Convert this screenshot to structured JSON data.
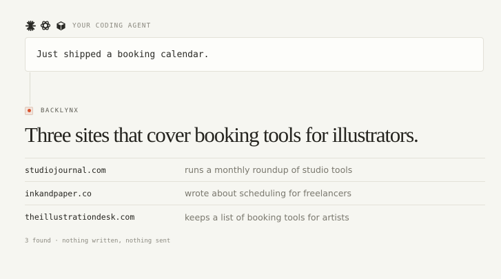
{
  "agent": {
    "icons": [
      "asterisk-burst-icon",
      "openai-knot-icon",
      "cube-icon"
    ],
    "label": "YOUR CODING AGENT"
  },
  "message": {
    "text": "Just shipped a booking calendar."
  },
  "brand": {
    "name": "BACKLYNX",
    "accent_color": "#d9532e"
  },
  "headline": "Three sites that cover booking tools for illustrators.",
  "results": [
    {
      "site": "studiojournal.com",
      "description": "runs a monthly roundup of studio tools"
    },
    {
      "site": "inkandpaper.co",
      "description": "wrote about scheduling for freelancers"
    },
    {
      "site": "theillustrationdesk.com",
      "description": "keeps a list of booking tools for artists"
    }
  ],
  "footer": "3 found · nothing written, nothing sent"
}
